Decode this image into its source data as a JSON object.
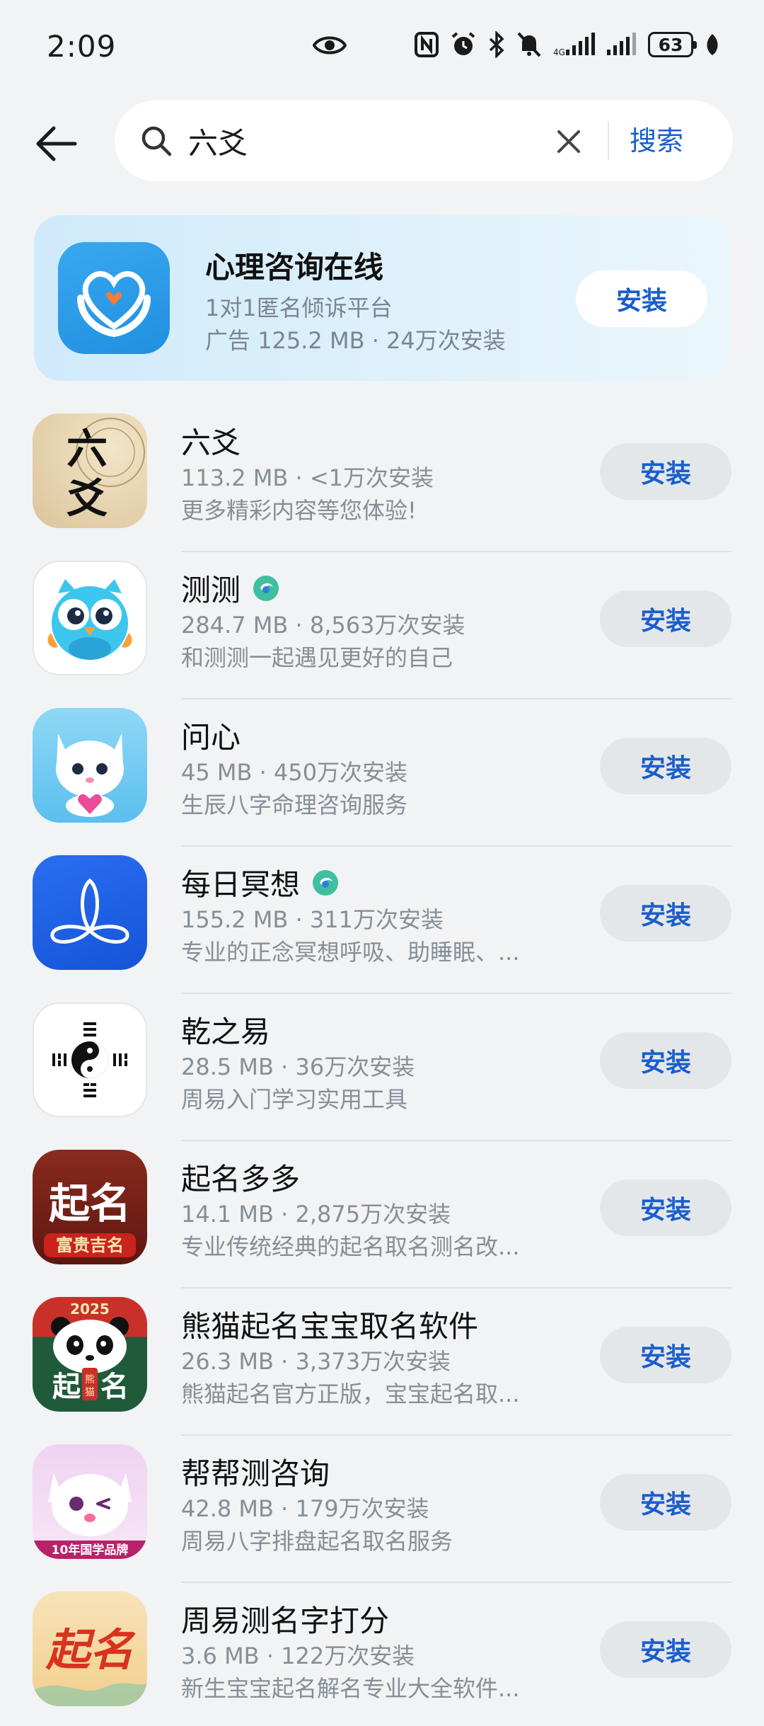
{
  "status": {
    "time": "2:09",
    "battery": "63"
  },
  "search": {
    "query": "六爻",
    "button_label": "搜索"
  },
  "ad": {
    "title": "心理咨询在线",
    "subtitle": "1对1匿名倾诉平台",
    "meta": "广告  125.2 MB · 24万次安装",
    "install_label": "安装",
    "icon": "heart-hands-icon"
  },
  "apps": [
    {
      "name": "六爻",
      "meta": "113.2 MB · <1万次安装",
      "desc": "更多精彩内容等您体验!",
      "install_label": "安装",
      "verified": false,
      "icon": "liuyao-icon",
      "icon_text": "六爻",
      "icon_bg": "#e9d8b8"
    },
    {
      "name": "测测",
      "meta": "284.7 MB · 8,563万次安装",
      "desc": "和测测一起遇见更好的自己",
      "install_label": "安装",
      "verified": true,
      "icon": "owl-icon",
      "icon_bg": "#ffffff"
    },
    {
      "name": "问心",
      "meta": "45 MB · 450万次安装",
      "desc": "生辰八字命理咨询服务",
      "install_label": "安装",
      "verified": false,
      "icon": "fox-icon",
      "icon_bg": "#7fd0f2"
    },
    {
      "name": "每日冥想",
      "meta": "155.2 MB · 311万次安装",
      "desc": "专业的正念冥想呼吸、助睡眠、...",
      "install_label": "安装",
      "verified": true,
      "icon": "meditation-icon",
      "icon_bg": "#1b5ee8"
    },
    {
      "name": "乾之易",
      "meta": "28.5 MB · 36万次安装",
      "desc": "周易入门学习实用工具",
      "install_label": "安装",
      "verified": false,
      "icon": "bagua-icon",
      "icon_bg": "#ffffff"
    },
    {
      "name": "起名多多",
      "meta": "14.1 MB · 2,875万次安装",
      "desc": "专业传统经典的起名取名测名改...",
      "install_label": "安装",
      "verified": false,
      "icon": "qiming-icon",
      "icon_text": "起名",
      "icon_sub": "富贵吉名",
      "icon_bg": "#7a1e16"
    },
    {
      "name": "熊猫起名宝宝取名软件",
      "meta": "26.3 MB · 3,373万次安装",
      "desc": "熊猫起名官方正版，宝宝起名取...",
      "install_label": "安装",
      "verified": false,
      "icon": "panda-icon",
      "icon_text": "起  名",
      "icon_sub": "2025",
      "icon_bg": "#1f5a3a"
    },
    {
      "name": "帮帮测咨询",
      "meta": "42.8 MB · 179万次安装",
      "desc": "周易八字排盘起名取名服务",
      "install_label": "安装",
      "verified": false,
      "icon": "cat-icon",
      "icon_sub": "10年国学品牌",
      "icon_bg": "#f3d9f3"
    },
    {
      "name": "周易测名字打分",
      "meta": "3.6 MB · 122万次安装",
      "desc": "新生宝宝起名解名专业大全软件...",
      "install_label": "安装",
      "verified": false,
      "icon": "qiming-red-icon",
      "icon_text": "起名",
      "icon_bg": "#f6dcaa"
    }
  ],
  "colors": {
    "accent": "#1a5ecb",
    "background": "#f1f3f5"
  }
}
